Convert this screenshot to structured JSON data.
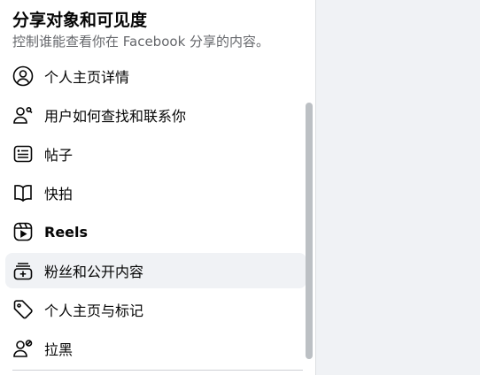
{
  "header": {
    "title": "分享对象和可见度",
    "subtitle": "控制谁能查看你在 Facebook 分享的内容。"
  },
  "menu": {
    "items": [
      {
        "label": "个人主页详情",
        "icon": "profile-circle-icon"
      },
      {
        "label": "用户如何查找和联系你",
        "icon": "person-search-icon"
      },
      {
        "label": "帖子",
        "icon": "post-icon"
      },
      {
        "label": "快拍",
        "icon": "book-icon"
      },
      {
        "label": "Reels",
        "icon": "reels-icon"
      },
      {
        "label": "粉丝和公开内容",
        "icon": "public-content-icon",
        "selected": true
      },
      {
        "label": "个人主页与标记",
        "icon": "tag-icon"
      },
      {
        "label": "拉黑",
        "icon": "block-user-icon"
      }
    ]
  },
  "colors": {
    "page_background": "#f0f2f5",
    "panel_background": "#ffffff",
    "secondary_text": "#65676b",
    "selected_item_background": "#f0f2f5",
    "scrollbar": "#bcc0c4"
  }
}
